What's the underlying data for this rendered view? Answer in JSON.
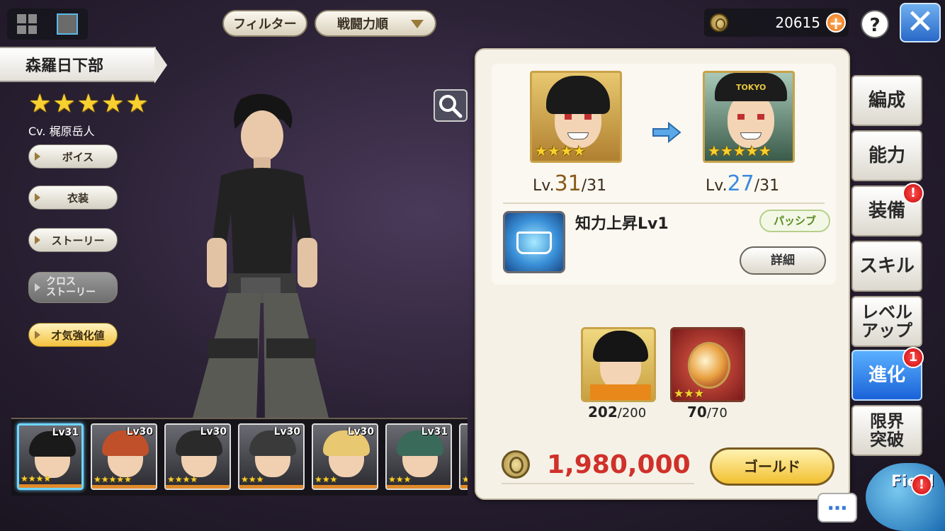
{
  "header": {
    "filter_label": "フィルター",
    "sort_label": "戦闘力順",
    "gold_amount": "20615",
    "plus_label": "+",
    "help_label": "?",
    "close_label": "✕"
  },
  "character": {
    "name": "森羅日下部",
    "stars": "★★★★★",
    "cv": "Cv. 梶原岳人"
  },
  "left_menu": {
    "voice": "ボイス",
    "costume": "衣装",
    "story": "ストーリー",
    "cross_story": "クロス\nストーリー",
    "talent": "才気強化値"
  },
  "roster": [
    {
      "level": "Lv31",
      "stars": "★★★★",
      "hair_color": "#1a1a1a",
      "selected": true
    },
    {
      "level": "Lv30",
      "stars": "★★★★★",
      "hair_color": "#c0502a",
      "selected": false
    },
    {
      "level": "Lv30",
      "stars": "★★★★",
      "hair_color": "#2a2a2a",
      "selected": false
    },
    {
      "level": "Lv30",
      "stars": "★★★",
      "hair_color": "#3a3a3a",
      "selected": false
    },
    {
      "level": "Lv30",
      "stars": "★★★",
      "hair_color": "#e8c870",
      "selected": false
    },
    {
      "level": "Lv31",
      "stars": "★★★",
      "hair_color": "#3a6a5a",
      "selected": false
    },
    {
      "level": "",
      "stars": "★",
      "hair_color": "#dddddd",
      "selected": false
    }
  ],
  "evolution": {
    "before_stars": "★★★★",
    "after_stars": "★★★★★",
    "before_level_prefix": "Lv.",
    "before_level": "31",
    "before_max": "/31",
    "after_level_prefix": "Lv.",
    "after_level": "27",
    "after_max": "/31",
    "skill_name": "知力上昇Lv1",
    "passive_label": "パッシブ",
    "detail_label": "詳細",
    "mat1_count": "202",
    "mat1_required": "/200",
    "mat2_stars": "★★★",
    "mat2_count": "70",
    "mat2_required": "/70",
    "cost": "1,980,000",
    "gold_button": "ゴールド"
  },
  "side_tabs": {
    "formation": "編成",
    "ability": "能力",
    "equipment": "装備",
    "skill": "スキル",
    "levelup": "レベル\nアップ",
    "evolution": "進化",
    "limit_break": "限界\n突破",
    "equipment_badge": "!",
    "evolution_badge": "1"
  },
  "footer": {
    "chat_label": "…",
    "field_label": "Field",
    "field_badge": "!"
  },
  "colors": {
    "accent_blue": "#1a62d8",
    "cost_red": "#d0302a",
    "badge_red": "#c80a0a",
    "star_gold": "#f8d030"
  }
}
